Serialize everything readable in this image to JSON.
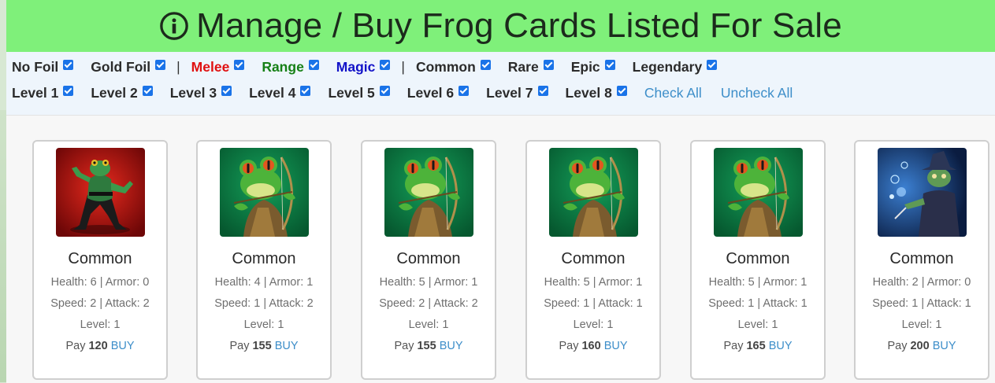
{
  "header": {
    "title": "Manage / Buy Frog Cards Listed For Sale"
  },
  "filters": {
    "row1": [
      {
        "label": "No Foil",
        "color": "#2b2b2b"
      },
      {
        "label": "Gold Foil",
        "color": "#2b2b2b"
      },
      {
        "sep": "|"
      },
      {
        "label": "Melee",
        "color": "#e01010"
      },
      {
        "label": "Range",
        "color": "#168016"
      },
      {
        "label": "Magic",
        "color": "#1212c8"
      },
      {
        "sep": "|"
      },
      {
        "label": "Common",
        "color": "#2b2b2b"
      },
      {
        "label": "Rare",
        "color": "#2b2b2b"
      },
      {
        "label": "Epic",
        "color": "#2b2b2b"
      },
      {
        "label": "Legendary",
        "color": "#2b2b2b"
      }
    ],
    "row2": [
      "Level 1",
      "Level 2",
      "Level 3",
      "Level 4",
      "Level 5",
      "Level 6",
      "Level 7",
      "Level 8"
    ],
    "check_all": "Check All",
    "uncheck_all": "Uncheck All"
  },
  "cards": [
    {
      "type": "melee",
      "rarity": "Common",
      "stats1": "Health: 6 | Armor: 0",
      "stats2": "Speed: 2 | Attack: 2",
      "level": "Level: 1",
      "pay_label": "Pay",
      "price": "120",
      "buy": "BUY"
    },
    {
      "type": "range",
      "rarity": "Common",
      "stats1": "Health: 4 | Armor: 1",
      "stats2": "Speed: 1 | Attack: 2",
      "level": "Level: 1",
      "pay_label": "Pay",
      "price": "155",
      "buy": "BUY"
    },
    {
      "type": "range",
      "rarity": "Common",
      "stats1": "Health: 5 | Armor: 1",
      "stats2": "Speed: 2 | Attack: 2",
      "level": "Level: 1",
      "pay_label": "Pay",
      "price": "155",
      "buy": "BUY"
    },
    {
      "type": "range",
      "rarity": "Common",
      "stats1": "Health: 5 | Armor: 1",
      "stats2": "Speed: 1 | Attack: 1",
      "level": "Level: 1",
      "pay_label": "Pay",
      "price": "160",
      "buy": "BUY"
    },
    {
      "type": "range",
      "rarity": "Common",
      "stats1": "Health: 5 | Armor: 1",
      "stats2": "Speed: 1 | Attack: 1",
      "level": "Level: 1",
      "pay_label": "Pay",
      "price": "165",
      "buy": "BUY"
    },
    {
      "type": "magic",
      "rarity": "Common",
      "stats1": "Health: 2 | Armor: 0",
      "stats2": "Speed: 1 | Attack: 1",
      "level": "Level: 1",
      "pay_label": "Pay",
      "price": "200",
      "buy": "BUY"
    }
  ]
}
